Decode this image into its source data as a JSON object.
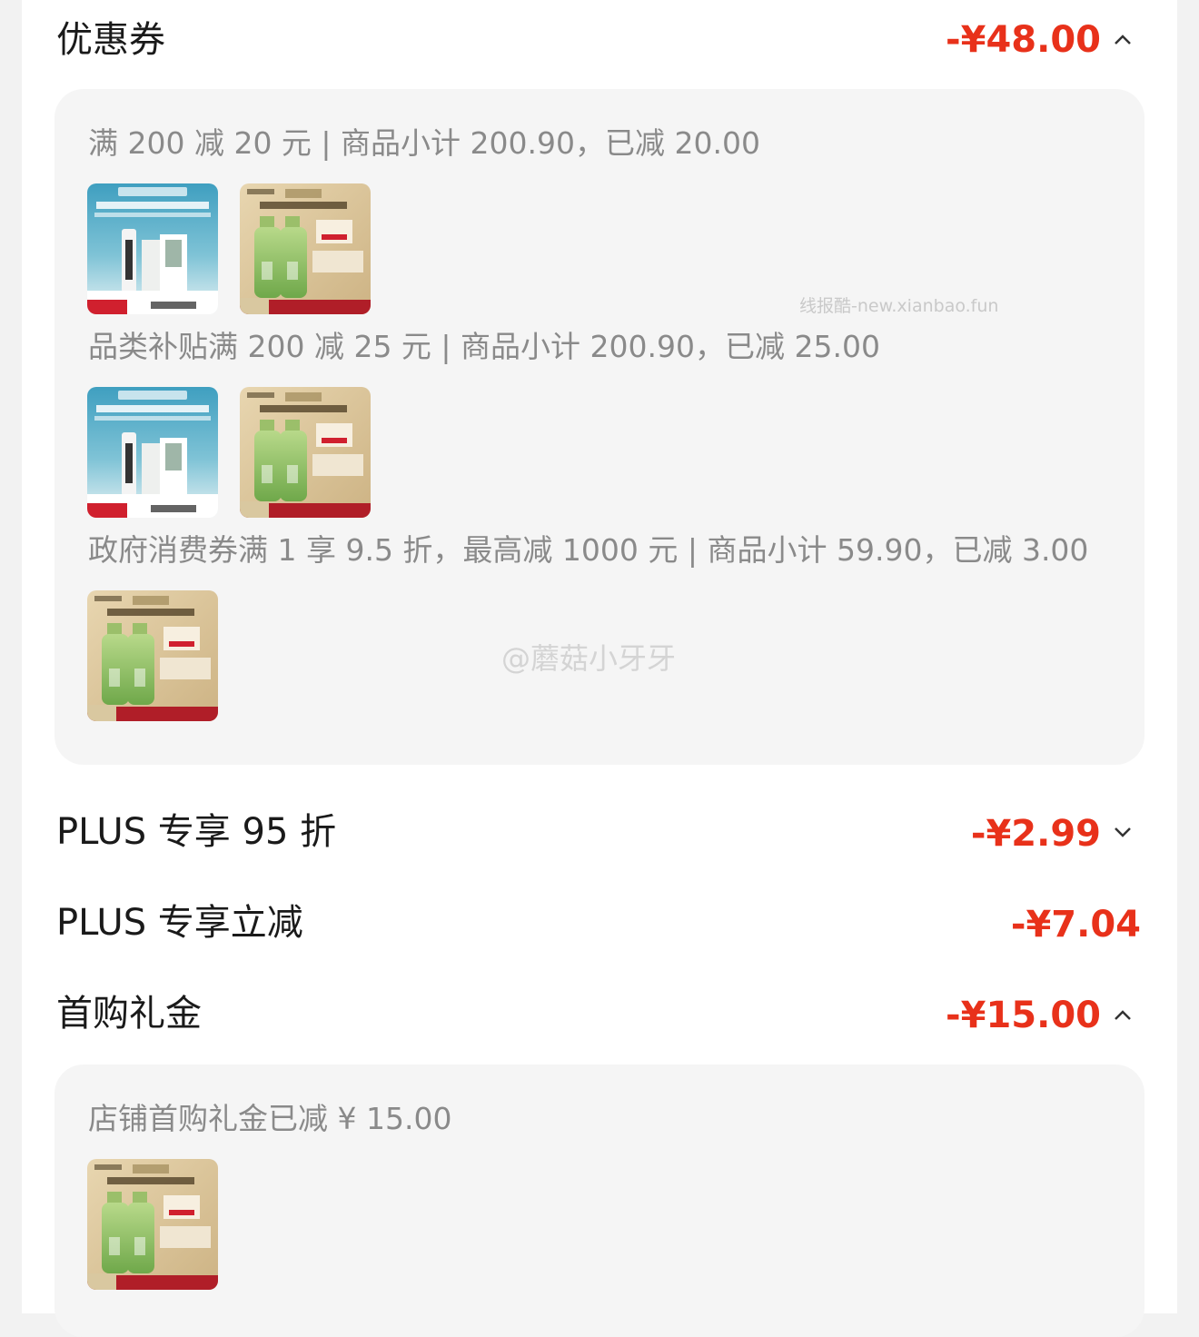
{
  "colors": {
    "accent_red": "#e8311a",
    "text_primary": "#1a1a1a",
    "text_secondary": "#8a8a8a"
  },
  "coupon": {
    "title": "优惠券",
    "amount": "-¥48.00",
    "chevron": "chevron-up-icon",
    "rules": [
      {
        "text": "满 200 减 20 元 | 商品小计 200.90，已减 20.00",
        "products": [
          "product-patch",
          "product-serum"
        ]
      },
      {
        "text": "品类补贴满 200 减 25 元 | 商品小计 200.90，已减 25.00",
        "products": [
          "product-patch",
          "product-serum"
        ]
      },
      {
        "text": "政府消费券满 1 享 9.5 折，最高减 1000 元 | 商品小计 59.90，已减 3.00",
        "products": [
          "product-serum"
        ]
      }
    ]
  },
  "plus_discount": {
    "title": "PLUS 专享 95 折",
    "amount": "-¥2.99",
    "chevron": "chevron-down-icon"
  },
  "plus_cut": {
    "title": "PLUS 专享立减",
    "amount": "-¥7.04"
  },
  "first_gift": {
    "title": "首购礼金",
    "amount": "-¥15.00",
    "chevron": "chevron-up-icon",
    "rules": [
      {
        "text": "店铺首购礼金已减 ¥ 15.00",
        "products": [
          "product-serum"
        ]
      }
    ]
  },
  "product_patch": {
    "brand": "肌力法 | 可复美",
    "headline": "夜痘膜 自淡印 精准狙击『突发痘』",
    "badge": "限冬特惠",
    "tag": "拍1到手7mL"
  },
  "product_serum": {
    "brand": "PECHOIN 百雀羚",
    "headline": "密集修护力 沁润不紧绷",
    "price_tag": "¥666",
    "badge": "74",
    "slogan": "成池轻薄 顺滑细腻"
  },
  "watermarks": {
    "site": "线报酷-new.xianbao.fun",
    "weibo": "@蘑菇小牙牙"
  }
}
